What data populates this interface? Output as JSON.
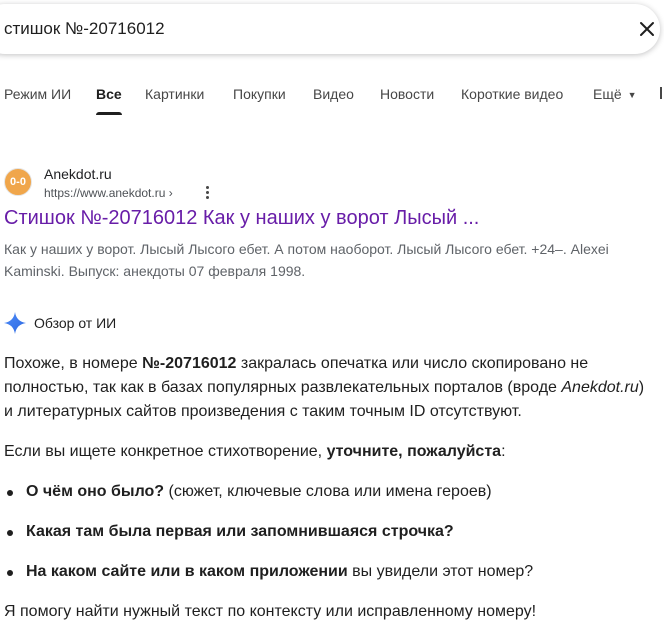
{
  "search": {
    "query": "стишок №-20716012"
  },
  "tabs": [
    {
      "label": "Режим ИИ"
    },
    {
      "label": "Все"
    },
    {
      "label": "Картинки"
    },
    {
      "label": "Покупки"
    },
    {
      "label": "Видео"
    },
    {
      "label": "Новости"
    },
    {
      "label": "Короткие видео"
    },
    {
      "label": "Ещё"
    }
  ],
  "result": {
    "favicon_text": "0-0",
    "site_name": "Anekdot.ru",
    "url": "https://www.anekdot.ru ›",
    "title": "Стишок №-20716012 Как у наших у ворот Лысый ...",
    "snippet": "Как у наших у ворот. Лысый Лысого ебет. А потом наоборот. Лысый Лысого ебет. +24–. Alexei Kaminski. Выпуск: анекдоты 07 февраля 1998."
  },
  "ai_overview": {
    "label": "Обзор от ИИ",
    "p1_before": "Похоже, в номере ",
    "p1_bold": "№-20716012",
    "p1_middle": " закралась опечатка или число скопировано не полностью, так как в базах популярных развлекательных порталов (вроде ",
    "p1_italic": "Anekdot.ru",
    "p1_after": ") и литературных сайтов произведения с таким точным ID отсутствуют.",
    "p2_before": "Если вы ищете конкретное стихотворение, ",
    "p2_bold": "уточните, пожалуйста",
    "p2_after": ":",
    "bullets": [
      {
        "bold": "О чём оно было?",
        "rest": " (сюжет, ключевые слова или имена героев)"
      },
      {
        "bold": "Какая там была первая или запомнившаяся строчка?",
        "rest": ""
      },
      {
        "bold": "На каком сайте или в каком приложении",
        "rest": " вы увидели этот номер?"
      }
    ],
    "closing": "Я помогу найти нужный текст по контексту или исправленному номеру!"
  },
  "colors": {
    "visited_link": "#681da8",
    "ai_star_blue": "#3c7bf5",
    "favicon_orange": "#f0a64b"
  },
  "icons": {
    "clear": "close-icon",
    "more": "more-vert-icon",
    "ai": "sparkle-icon",
    "dropdown": "chevron-down-icon"
  }
}
